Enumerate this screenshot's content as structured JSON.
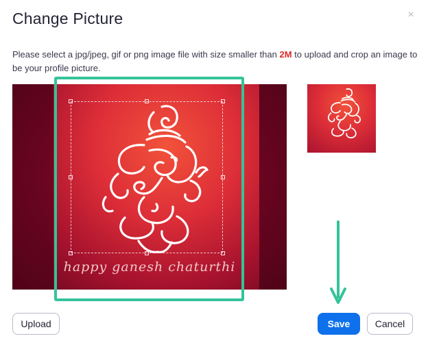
{
  "dialog": {
    "title": "Change Picture",
    "close_glyph": "×",
    "description": {
      "part1": "Please select a jpg/jpeg, gif or png image file with size smaller than ",
      "highlight": "2M",
      "part2": " to upload and crop an image to be your profile picture."
    },
    "image_caption": "happy ganesh chaturthi"
  },
  "buttons": {
    "upload": "Upload",
    "save": "Save",
    "cancel": "Cancel"
  },
  "colors": {
    "accent_blue": "#0e71eb",
    "highlight_green": "#34c39a",
    "warning_red": "#e02828"
  },
  "icons": [
    "close-icon",
    "ganesha-artwork",
    "down-arrow-annotation"
  ]
}
